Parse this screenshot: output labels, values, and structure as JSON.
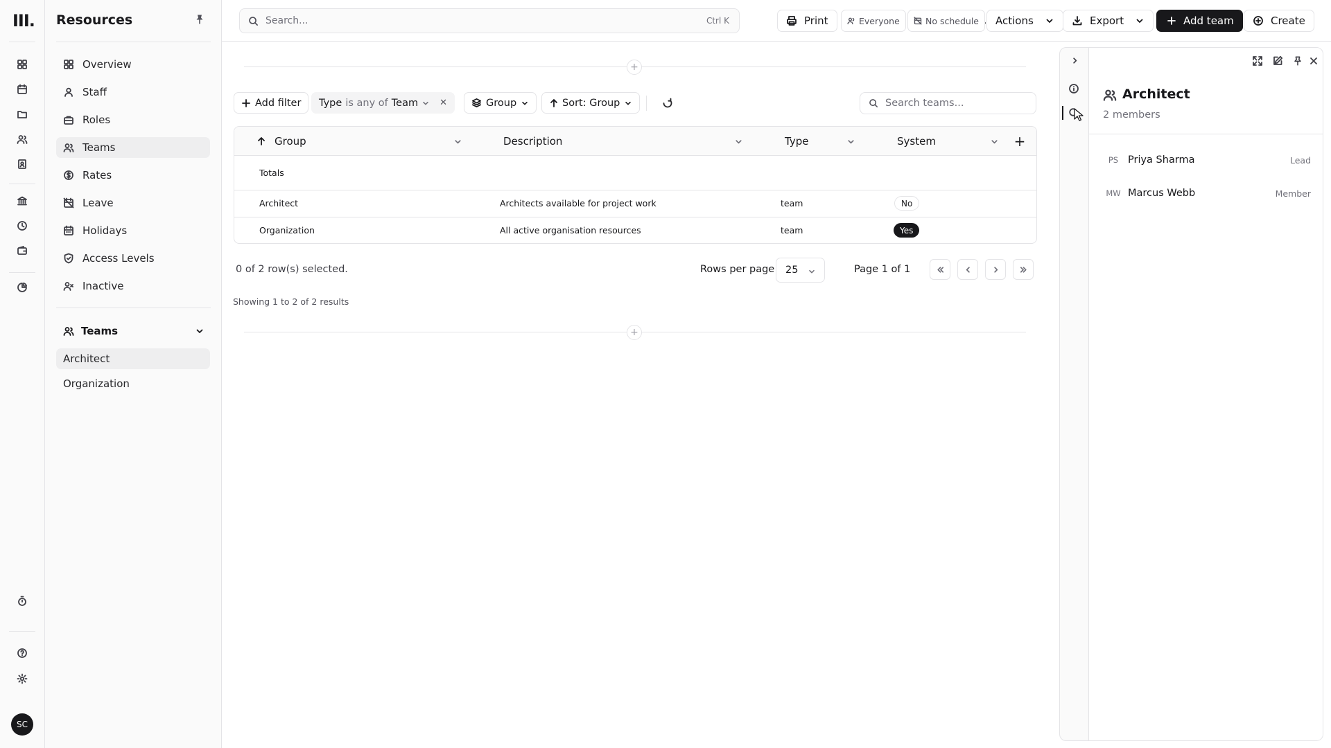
{
  "app": {
    "logo": "III.",
    "user_initials": "SC"
  },
  "nav": {
    "title": "Resources",
    "items": [
      {
        "label": "Overview",
        "icon": "grid-icon"
      },
      {
        "label": "Staff",
        "icon": "user-icon"
      },
      {
        "label": "Roles",
        "icon": "briefcase-icon"
      },
      {
        "label": "Teams",
        "icon": "users-icon"
      },
      {
        "label": "Rates",
        "icon": "dollar-icon"
      },
      {
        "label": "Leave",
        "icon": "calendar-off-icon"
      },
      {
        "label": "Holidays",
        "icon": "calendar-icon"
      },
      {
        "label": "Access Levels",
        "icon": "shield-icon"
      },
      {
        "label": "Inactive",
        "icon": "user-x-icon"
      }
    ],
    "section": {
      "label": "Teams",
      "items": [
        {
          "label": "Architect"
        },
        {
          "label": "Organization"
        }
      ]
    }
  },
  "topbar": {
    "search_placeholder": "Search...",
    "search_shortcut": "Ctrl K",
    "print": "Print",
    "everyone": "Everyone",
    "schedule": "No schedule",
    "actions": "Actions",
    "export": "Export",
    "add_team": "Add team",
    "create": "Create"
  },
  "toolbar": {
    "add_filter": "Add filter",
    "filter": {
      "field": "Type",
      "op": "is any of",
      "value": "Team"
    },
    "group": "Group",
    "sort": "Sort: Group",
    "search_placeholder": "Search teams..."
  },
  "table": {
    "columns": [
      "Group",
      "Description",
      "Type",
      "System"
    ],
    "totals_label": "Totals",
    "rows": [
      {
        "group": "Architect",
        "description": "Architects available for project work",
        "type": "team",
        "system": "No"
      },
      {
        "group": "Organization",
        "description": "All active organisation resources",
        "type": "team",
        "system": "Yes"
      }
    ]
  },
  "pagination": {
    "selected": "0 of 2 row(s) selected.",
    "rows_per_page_label": "Rows per page",
    "rows_per_page": "25",
    "page": "Page 1 of 1",
    "showing": "Showing 1 to 2 of 2 results"
  },
  "panel": {
    "title": "Architect",
    "subtitle": "2 members",
    "members": [
      {
        "initials": "PS",
        "name": "Priya Sharma",
        "role": "Lead"
      },
      {
        "initials": "MW",
        "name": "Marcus Webb",
        "role": "Member"
      }
    ]
  },
  "colors": {
    "primary": "#18181b",
    "border": "#e4e4e7",
    "muted": "#71717a",
    "sidebar_bg": "#fafafa"
  }
}
